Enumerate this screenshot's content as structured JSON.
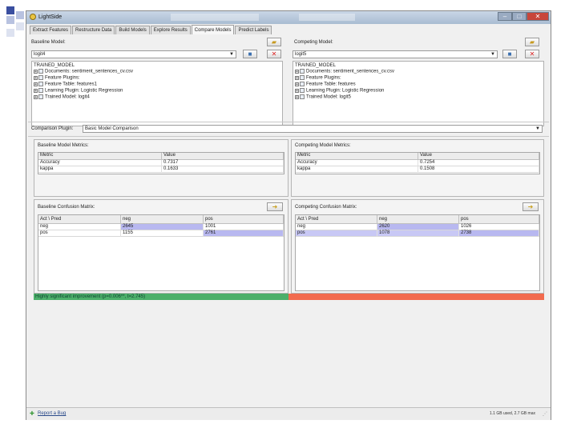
{
  "window": {
    "title": "LightSide",
    "controls": [
      "–",
      "□",
      "✕"
    ]
  },
  "tabs": [
    {
      "label": "Extract Features",
      "active": false
    },
    {
      "label": "Restructure Data",
      "active": false
    },
    {
      "label": "Build Models",
      "active": false
    },
    {
      "label": "Explore Results",
      "active": false
    },
    {
      "label": "Compare Models",
      "active": true
    },
    {
      "label": "Predict Labels",
      "active": false
    }
  ],
  "baseline": {
    "label": "Baseline Model:",
    "selected": "logit4",
    "tree": {
      "root": "TRAINED_MODEL",
      "items": [
        "Documents: sentiment_sentences_cv.csv",
        "Feature Plugins:",
        "Feature Table: features1",
        "Learning Plugin: Logistic Regression",
        "Trained Model: logit4"
      ]
    },
    "metrics": {
      "title": "Baseline Model Metrics:",
      "headers": [
        "Metric",
        "Value"
      ],
      "rows": [
        [
          "Accuracy",
          "0.7317"
        ],
        [
          "kappa",
          "0.1633"
        ]
      ]
    },
    "confusion": {
      "title": "Baseline Confusion Matrix:",
      "headers": [
        "Act \\ Pred",
        "neg",
        "pos"
      ],
      "rows": [
        [
          "neg",
          "2645",
          "1001"
        ],
        [
          "pos",
          "1155",
          "2761"
        ]
      ]
    }
  },
  "competing": {
    "label": "Competing Model:",
    "selected": "logit5",
    "tree": {
      "root": "TRAINED_MODEL",
      "items": [
        "Documents: sentiment_sentences_cv.csv",
        "Feature Plugins:",
        "Feature Table: features",
        "Learning Plugin: Logistic Regression",
        "Trained Model: logit5"
      ]
    },
    "metrics": {
      "title": "Competing Model Metrics:",
      "headers": [
        "Metric",
        "Value"
      ],
      "rows": [
        [
          "Accuracy",
          "0.7254"
        ],
        [
          "kappa",
          "0.1508"
        ]
      ]
    },
    "confusion": {
      "title": "Competing Confusion Matrix:",
      "headers": [
        "Act \\ Pred",
        "neg",
        "pos"
      ],
      "rows": [
        [
          "neg",
          "2620",
          "1026"
        ],
        [
          "pos",
          "1078",
          "2738"
        ]
      ]
    }
  },
  "comparison": {
    "label": "Comparison Plugin:",
    "selected": "Basic Model Comparison"
  },
  "significance": {
    "text": "Highly significant improvement (p=0.006**, t=2.745)",
    "left_color": "#4caf6a",
    "right_color": "#f26b4f"
  },
  "status": {
    "report": "Report a Bug",
    "memory": "1.1 GB used, 2.7 GB max"
  },
  "colors": {
    "cell_highlight": "#b8b8f0",
    "row_highlight": "#c8c8f5"
  }
}
